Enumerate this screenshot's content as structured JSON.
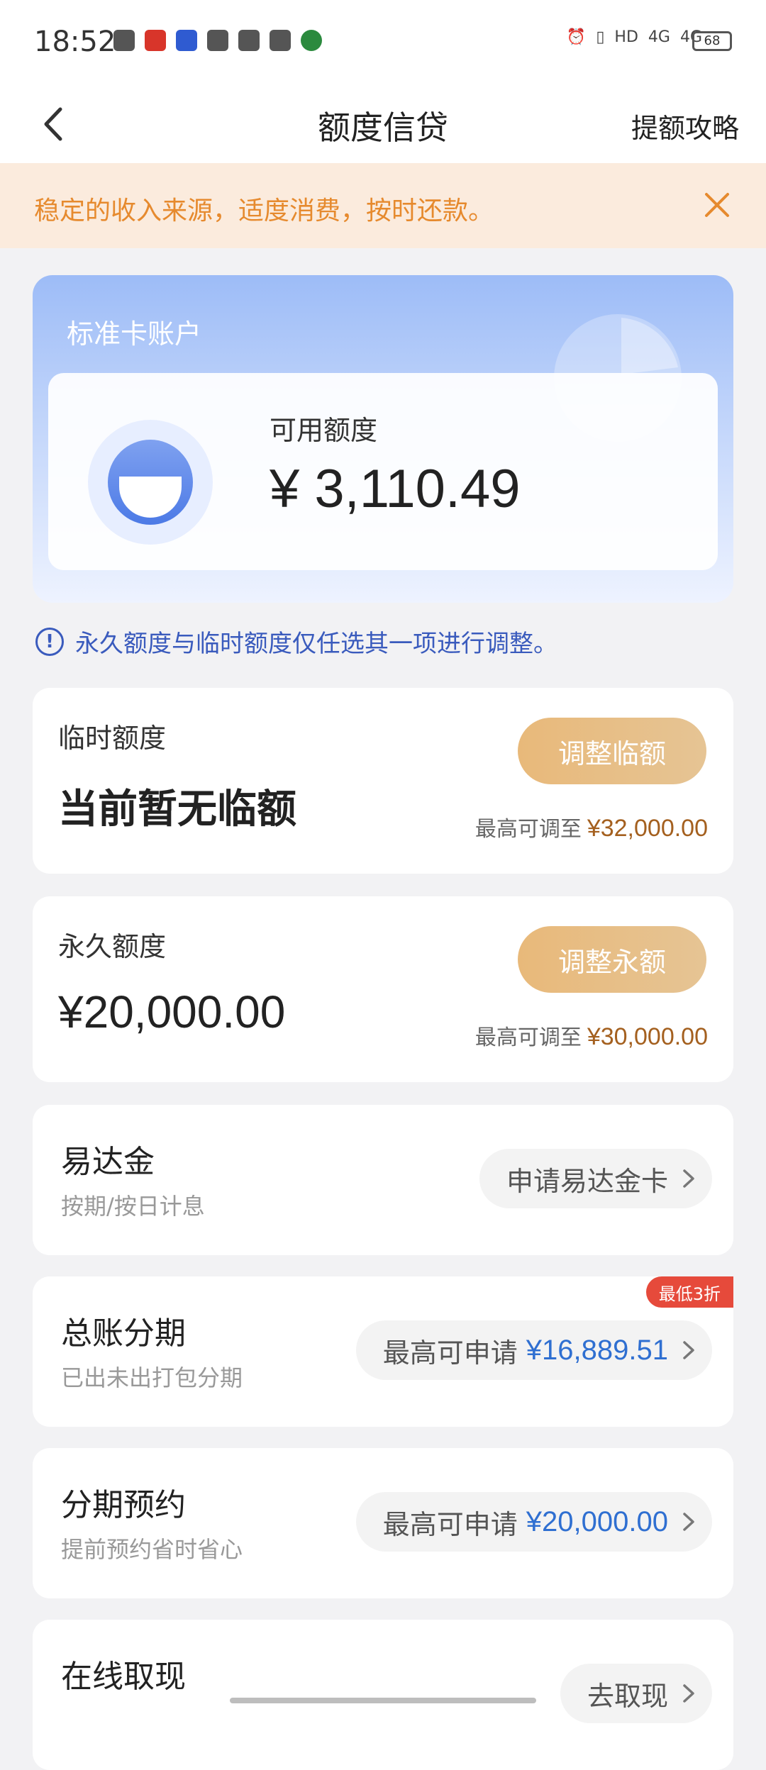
{
  "status_bar": {
    "time": "18:52",
    "network_1": "HD",
    "network_2": "4G",
    "network_3": "4G",
    "battery": "68"
  },
  "header": {
    "title": "额度信贷",
    "right_link": "提额攻略"
  },
  "notice": {
    "text": "稳定的收入来源，适度消费，按时还款。"
  },
  "account": {
    "label": "标准卡账户",
    "available_label": "可用额度",
    "available_amount": "¥ 3,110.49"
  },
  "tip": {
    "text": "永久额度与临时额度仅任选其一项进行调整。"
  },
  "temporary_limit": {
    "label": "临时额度",
    "value": "当前暂无临额",
    "button": "调整临额",
    "max_label": "最高可调至",
    "max_amount": "¥32,000.00"
  },
  "permanent_limit": {
    "label": "永久额度",
    "value": "¥20,000.00",
    "button": "调整永额",
    "max_label": "最高可调至",
    "max_amount": "¥30,000.00"
  },
  "products": [
    {
      "name": "易达金",
      "sub": "按期/按日计息",
      "action": "申请易达金卡",
      "amount": ""
    },
    {
      "name": "总账分期",
      "sub": "已出未出打包分期",
      "action": "最高可申请",
      "amount": "¥16,889.51",
      "badge": "最低3折"
    },
    {
      "name": "分期预约",
      "sub": "提前预约省时省心",
      "action": "最高可申请",
      "amount": "¥20,000.00"
    },
    {
      "name": "在线取现",
      "sub": "",
      "action": "去取现",
      "amount": ""
    }
  ]
}
